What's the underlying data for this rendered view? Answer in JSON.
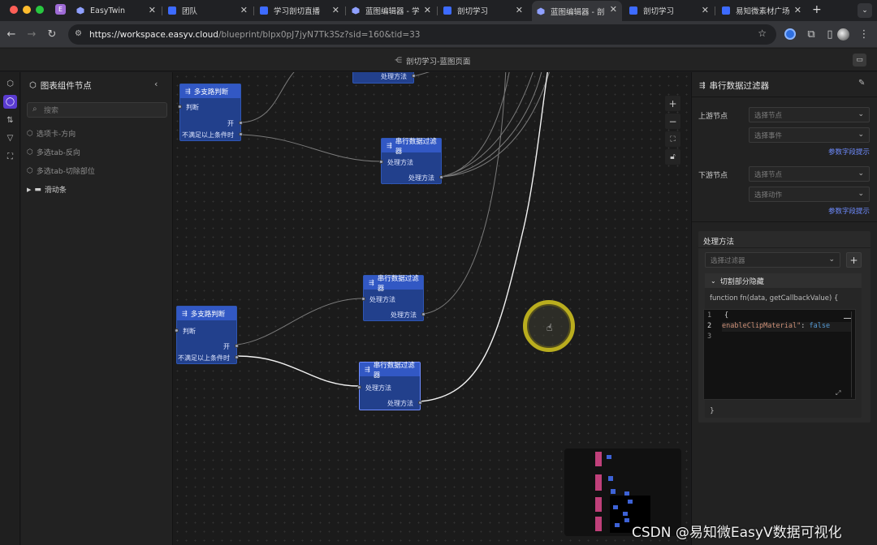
{
  "browser": {
    "tabs": [
      {
        "title": "EasyTwin"
      },
      {
        "title": "团队"
      },
      {
        "title": "学习剖切直播"
      },
      {
        "title": "蓝图编辑器 - 学"
      },
      {
        "title": "剖切学习"
      },
      {
        "title": "蓝图编辑器 - 剖"
      },
      {
        "title": "剖切学习"
      },
      {
        "title": "易知微素材广场"
      }
    ],
    "new_tab": "+",
    "url_host": "https://workspace.easyv.cloud",
    "url_path": "/blueprint/blpx0pJ7jyN7Tk3Sz?sid=160&tid=33"
  },
  "app": {
    "page_title": "剖切学习-蓝图页面"
  },
  "left_panel": {
    "title": "图表组件节点",
    "search_placeholder": "搜索",
    "items": [
      {
        "label": "选项卡-方向"
      },
      {
        "label": "多选tab-反向"
      },
      {
        "label": "多选tab-切除部位"
      }
    ],
    "folder": {
      "label": "滑动条"
    }
  },
  "canvas": {
    "nodes": {
      "branch1": {
        "title": "多支路判断",
        "in_port": "判断",
        "out_open": "开",
        "out_else": "不满足以上条件时"
      },
      "top_partial": {
        "port": "处理方法"
      },
      "filter1": {
        "title": "串行数据过滤器",
        "in_port": "处理方法",
        "out_port": "处理方法"
      },
      "branch2": {
        "title": "多支路判断",
        "in_port": "判断",
        "out_open": "开",
        "out_else": "不满足以上条件时"
      },
      "filter2": {
        "title": "串行数据过滤器",
        "in_port": "处理方法",
        "out_port": "处理方法"
      },
      "filter3": {
        "title": "串行数据过滤器",
        "in_port": "处理方法",
        "out_port": "处理方法"
      }
    },
    "zoom_tools": {
      "zoom_in": "+",
      "zoom_out": "−"
    }
  },
  "right_panel": {
    "title": "串行数据过滤器",
    "upstream_label": "上游节点",
    "upstream_node_placeholder": "选择节点",
    "upstream_event_placeholder": "选择事件",
    "param_hint": "参数字段提示",
    "downstream_label": "下游节点",
    "downstream_node_placeholder": "选择节点",
    "downstream_action_placeholder": "选择动作",
    "method_title": "处理方法",
    "filter_placeholder": "选择过滤器",
    "add_label": "+",
    "collapse_title": "切割部分隐藏",
    "code": {
      "signature": "function fn(data, getCallbackValue) {",
      "line_numbers": [
        "1",
        "2",
        "3"
      ],
      "line1": "{",
      "line2_key": "enableClipMaterial\"",
      "line2_colon": ": ",
      "line2_value": "false",
      "closing": "}"
    }
  },
  "watermark": "CSDN @易知微EasyV数据可视化",
  "colors": {
    "node_header": "#3258c4",
    "node_body": "#22408c",
    "link": "#6f8cff",
    "cursor_ring": "#b9ad1e"
  }
}
